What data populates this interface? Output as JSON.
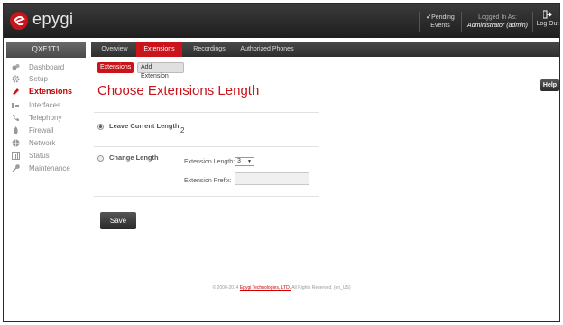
{
  "brand": {
    "name": "epygi"
  },
  "header": {
    "pending": {
      "line1": "✔Pending",
      "line2": "Events"
    },
    "logged": {
      "label": "Logged In As:",
      "user": "Administrator (admin)"
    },
    "logout": "Log Out"
  },
  "sidebar": {
    "device": "QXE1T1",
    "items": [
      {
        "label": "Dashboard",
        "icon": "dashboard-icon"
      },
      {
        "label": "Setup",
        "icon": "gear-icon"
      },
      {
        "label": "Extensions",
        "icon": "extensions-icon",
        "active": true
      },
      {
        "label": "Interfaces",
        "icon": "interfaces-icon"
      },
      {
        "label": "Telephony",
        "icon": "phone-icon"
      },
      {
        "label": "Firewall",
        "icon": "firewall-icon"
      },
      {
        "label": "Network",
        "icon": "globe-icon"
      },
      {
        "label": "Status",
        "icon": "status-icon"
      },
      {
        "label": "Maintenance",
        "icon": "wrench-icon"
      }
    ]
  },
  "tabs": [
    "Overview",
    "Extensions",
    "Recordings",
    "Authorized Phones"
  ],
  "subtabs": [
    "Extensions",
    "Add Extension"
  ],
  "help": "Help",
  "title": "Choose Extensions Length",
  "form": {
    "leave": {
      "label": "Leave Current Length",
      "value": "2"
    },
    "change": {
      "label": "Change Length",
      "length_label": "Extension Length:",
      "length_value": "3",
      "prefix_label": "Extension Prefix:",
      "prefix_value": ""
    }
  },
  "save": "Save",
  "footer": {
    "pre": "© 2000-2014 ",
    "link": "Epygi Technologies, LTD.",
    "post": " All Rights Reserved. (en_US)"
  },
  "colors": {
    "accent": "#c8141a",
    "bar": "#2e2e2e"
  }
}
